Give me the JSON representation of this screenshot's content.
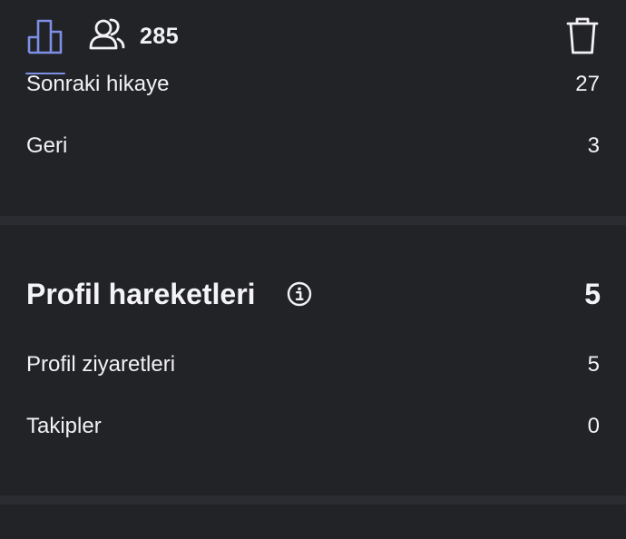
{
  "header": {
    "insights_tab_icon": "bar-chart-icon",
    "viewers_tab_icon": "viewers-icon",
    "viewer_count": "285",
    "delete_icon": "trash-icon",
    "accent_color": "#7e8fe6"
  },
  "navigation_rows": [
    {
      "label": "Sonraki hikaye",
      "value": "27"
    },
    {
      "label": "Geri",
      "value": "3"
    }
  ],
  "profile_activity": {
    "title": "Profil hareketleri",
    "info_icon": "info-icon",
    "total": "5",
    "rows": [
      {
        "label": "Profil ziyaretleri",
        "value": "5"
      },
      {
        "label": "Takipler",
        "value": "0"
      }
    ]
  },
  "colors": {
    "background": "#222327",
    "divider": "#2b2c31",
    "text": "#f2f2f5"
  }
}
